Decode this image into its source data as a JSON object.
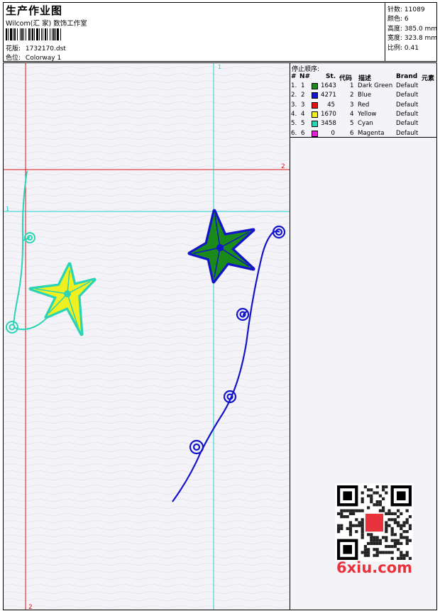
{
  "header": {
    "title": "生产作业图",
    "studio": "Wilcom(汇 家) 数饰工作室",
    "pattern_label": "花版:",
    "pattern_value": "1732170.dst",
    "colorway_label": "色位:",
    "colorway_value": "Colorway 1",
    "stitches_label": "针数:",
    "stitches_value": "11089",
    "colors_label": "颜色:",
    "colors_value": "6",
    "height_label": "高度:",
    "height_value": "385.0 mm",
    "width_label": "宽度:",
    "width_value": "323.8 mm",
    "scale_label": "比例:",
    "scale_value": "0.41"
  },
  "canvas": {
    "guides": {
      "red_vertical_label": "2",
      "red_horizontal_label": "2",
      "cyan_vertical_label": "1",
      "cyan_horizontal_label": "1"
    }
  },
  "stop_sequence": {
    "title": "停止顺序:",
    "columns": [
      "#",
      "N#",
      "St.",
      "代码",
      "描述",
      "Brand",
      "元素"
    ],
    "rows": [
      {
        "num": "1.",
        "n": "1",
        "color": "#1a8a1a",
        "st": "1643",
        "code": "1",
        "desc": "Dark Green",
        "brand": "Default"
      },
      {
        "num": "2.",
        "n": "2",
        "color": "#1414c8",
        "st": "4271",
        "code": "2",
        "desc": "Blue",
        "brand": "Default"
      },
      {
        "num": "3.",
        "n": "3",
        "color": "#e01414",
        "st": "45",
        "code": "3",
        "desc": "Red",
        "brand": "Default"
      },
      {
        "num": "4.",
        "n": "4",
        "color": "#f0f020",
        "st": "1670",
        "code": "4",
        "desc": "Yellow",
        "brand": "Default"
      },
      {
        "num": "5.",
        "n": "5",
        "color": "#2ad4b4",
        "st": "3458",
        "code": "5",
        "desc": "Cyan",
        "brand": "Default"
      },
      {
        "num": "6.",
        "n": "6",
        "color": "#e020d0",
        "st": "0",
        "code": "6",
        "desc": "Magenta",
        "brand": "Default"
      }
    ]
  },
  "watermark": {
    "text": "6xiu.com"
  }
}
